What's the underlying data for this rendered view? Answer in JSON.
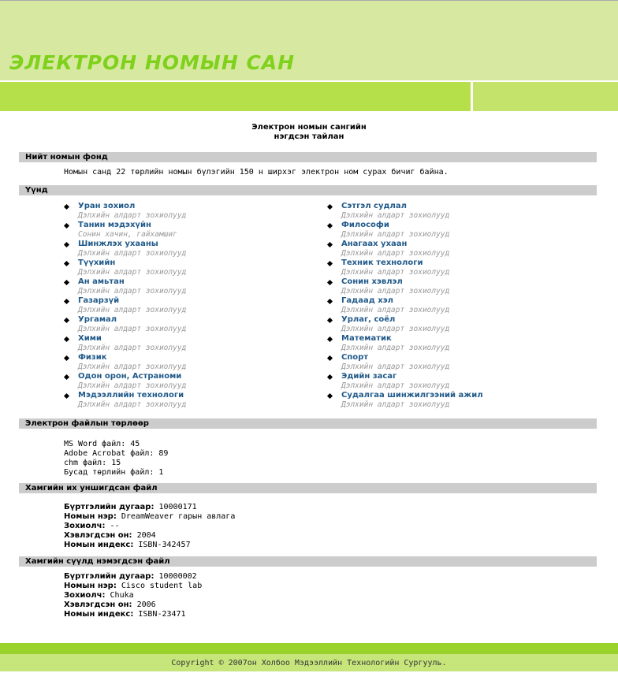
{
  "header": {
    "title": "ЭЛЕКТРОН НОМЫН САН"
  },
  "report": {
    "line1": "Электрон номын сангийн",
    "line2": "нэгдсэн тайлан"
  },
  "sections": {
    "total": "Нийт номын фонд",
    "categories": "Үүнд",
    "file_types": "Электрон файлын төрлөөр",
    "most_read": "Хамгийн их уншигдсан файл",
    "latest": "Хамгийн сүүлд нэмэгдсэн файл"
  },
  "total_text": "Номын санд 22 төрлийн номын бүлэгийн 150 н ширхэг электрон ном сурах бичиг байна.",
  "categories_left": [
    {
      "name": "Уран зохиол",
      "desc": "Дэлхийн алдарт зохиолууд"
    },
    {
      "name": "Танин мэдэхүйн",
      "desc": "Сонин хачин, гайхамшиг"
    },
    {
      "name": "Шинжлэх ухааны",
      "desc": "Дэлхийн алдарт зохиолууд"
    },
    {
      "name": "Түүхийн",
      "desc": "Дэлхийн алдарт зохиолууд"
    },
    {
      "name": "Ан амьтан",
      "desc": "Дэлхийн алдарт зохиолууд"
    },
    {
      "name": "Газарзүй",
      "desc": "Дэлхийн алдарт зохиолууд"
    },
    {
      "name": "Ургамал",
      "desc": "Дэлхийн алдарт зохиолууд"
    },
    {
      "name": "Хими",
      "desc": "Дэлхийн алдарт зохиолууд"
    },
    {
      "name": "Физик",
      "desc": "Дэлхийн алдарт зохиолууд"
    },
    {
      "name": "Одон орон, Астраноми",
      "desc": "Дэлхийн алдарт зохиолууд"
    },
    {
      "name": "Мэдээллийн технологи",
      "desc": "Дэлхийн алдарт зохиолууд"
    }
  ],
  "categories_right": [
    {
      "name": "Сэтгэл судлал",
      "desc": "Дэлхийн алдарт зохиолууд"
    },
    {
      "name": "Философи",
      "desc": "Дэлхийн алдарт зохиолууд"
    },
    {
      "name": "Анагаах ухаан",
      "desc": "Дэлхийн алдарт зохиолууд"
    },
    {
      "name": "Техник технологи",
      "desc": "Дэлхийн алдарт зохиолууд"
    },
    {
      "name": "Сонин хэвлэл",
      "desc": "Дэлхийн алдарт зохиолууд"
    },
    {
      "name": "Гадаад хэл",
      "desc": "Дэлхийн алдарт зохиолууд"
    },
    {
      "name": "Урлаг, соёл",
      "desc": "Дэлхийн алдарт зохиолууд"
    },
    {
      "name": "Математик",
      "desc": "Дэлхийн алдарт зохиолууд"
    },
    {
      "name": "Спорт",
      "desc": "Дэлхийн алдарт зохиолууд"
    },
    {
      "name": "Эдийн засаг",
      "desc": "Дэлхийн алдарт зохиолууд"
    },
    {
      "name": "Судалгаа шинжилгээний ажил",
      "desc": "Дэлхийн алдарт зохиолууд"
    }
  ],
  "file_types": [
    "MS Word файл: 45",
    "Adobe Acrobat файл: 89",
    "chm файл: 15",
    "Бусад төрлийн файл: 1"
  ],
  "labels": {
    "reg": "Бүртгэлийн дугаар:",
    "name": "Номын нэр:",
    "author": "Зохиолч:",
    "year": "Хэвлэгдсэн он:",
    "index": "Номын индекс:"
  },
  "most_read": {
    "reg": "10000171",
    "name": "DreamWeaver гарын авлага",
    "author": "--",
    "year": "2004",
    "index": "ISBN-342457"
  },
  "latest": {
    "reg": "10000002",
    "name": "Cisco student lab",
    "author": "Chuka",
    "year": "2006",
    "index": "ISBN-23471"
  },
  "footer": "Copyright © 2007он Холбоо Мэдээллийн Технологийн Сургууль."
}
